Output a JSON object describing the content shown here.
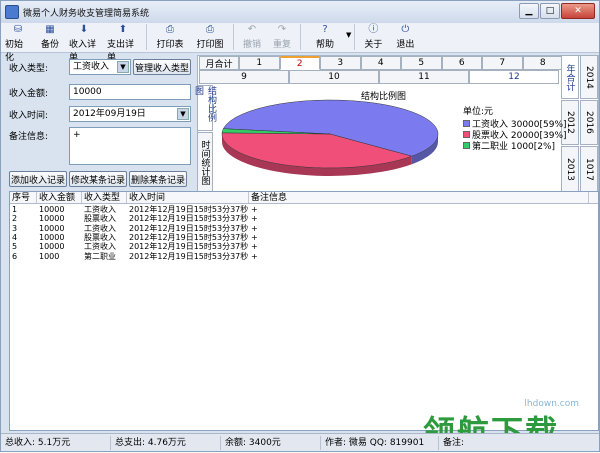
{
  "window": {
    "title": "微易个人财务收支管理简易系统"
  },
  "toolbar": [
    {
      "id": "init",
      "label": "初始化",
      "icon": "init-icon",
      "glyph": "⛁"
    },
    {
      "id": "backup",
      "label": "备份",
      "icon": "backup-icon",
      "glyph": "▦"
    },
    {
      "id": "income_detail",
      "label": "收入详单",
      "icon": "income-detail-icon",
      "glyph": "⬇"
    },
    {
      "id": "expense_detail",
      "label": "支出详单",
      "icon": "expense-detail-icon",
      "glyph": "⬆"
    },
    {
      "id": "print_table",
      "label": "打印表",
      "icon": "print-table-icon",
      "glyph": "⎙"
    },
    {
      "id": "print_chart",
      "label": "打印图",
      "icon": "print-chart-icon",
      "glyph": "⎙"
    },
    {
      "id": "undo",
      "label": "撤销",
      "icon": "undo-icon",
      "glyph": "↶",
      "disabled": true
    },
    {
      "id": "redo",
      "label": "重复",
      "icon": "redo-icon",
      "glyph": "↷",
      "disabled": true
    },
    {
      "id": "help",
      "label": "帮助",
      "icon": "help-icon",
      "glyph": "?"
    },
    {
      "id": "about",
      "label": "关于",
      "icon": "about-icon",
      "glyph": "ⓘ"
    },
    {
      "id": "exit",
      "label": "退出",
      "icon": "exit-icon",
      "glyph": "⏻"
    }
  ],
  "form": {
    "type_label": "收入类型:",
    "type_value": "工资收入",
    "manage_button": "管理收入类型",
    "amount_label": "收入金额:",
    "amount_value": "10000",
    "time_label": "收入时间:",
    "time_value": "2012年09月19日",
    "note_label": "备注信息:",
    "note_value": "+",
    "add_button": "添加收入记录",
    "modify_button": "修改某条记录",
    "delete_button": "删除某条记录"
  },
  "chart_tabs": {
    "month_total": "月合计",
    "months_row1": [
      "1",
      "2",
      "3",
      "4",
      "5",
      "6",
      "7",
      "8"
    ],
    "months_row2": [
      "9",
      "10",
      "11",
      "12"
    ],
    "active_month": "2",
    "selected_month": "12",
    "left_vertical": [
      "结构比例图",
      "时间统计图"
    ],
    "right_years": [
      "年合计",
      "2014",
      "2012",
      "2016",
      "2013",
      "1017"
    ]
  },
  "chart_data": {
    "type": "pie",
    "title": "结构比例图",
    "unit_label": "单位:元",
    "slices": [
      {
        "name": "工资收入",
        "value": 30000,
        "percent": 59,
        "label": "工资收入 30000[59%]",
        "color": "#7b7bef"
      },
      {
        "name": "股票收入",
        "value": 20000,
        "percent": 39,
        "label": "股票收入 20000[39%]",
        "color": "#ef4f79"
      },
      {
        "name": "第二职业",
        "value": 1000,
        "percent": 2,
        "label": "第二职业 1000[2%]",
        "color": "#33cc66"
      }
    ]
  },
  "table": {
    "headers": [
      "序号",
      "收入金额",
      "收入类型",
      "收入时间",
      "备注信息"
    ],
    "rows": [
      [
        "1",
        "10000",
        "工资收入",
        "2012年12月19日15时53分37秒",
        "+"
      ],
      [
        "2",
        "10000",
        "股票收入",
        "2012年12月19日15时53分37秒",
        "+"
      ],
      [
        "3",
        "10000",
        "工资收入",
        "2012年12月19日15时53分37秒",
        "+"
      ],
      [
        "4",
        "10000",
        "股票收入",
        "2012年12月19日15时53分37秒",
        "+"
      ],
      [
        "5",
        "10000",
        "工资收入",
        "2012年12月19日15时53分37秒",
        "+"
      ],
      [
        "6",
        "1000",
        "第二职业",
        "2012年12月19日15时53分37秒",
        "+"
      ]
    ]
  },
  "status": {
    "income": "总收入: 5.1万元",
    "expense": "总支出: 4.76万元",
    "balance": "余额: 3400元",
    "author": "作者: 微易 QQ: 819901",
    "note": "备注:"
  },
  "watermark": {
    "url": "lhdown.com",
    "text": "领航下载"
  }
}
